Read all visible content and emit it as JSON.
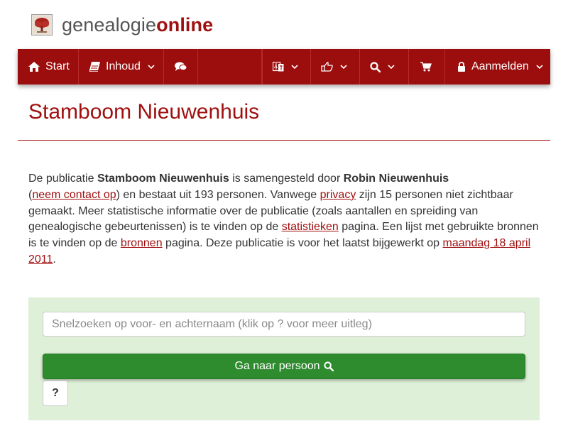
{
  "header": {
    "logo_icon": "tree-icon",
    "logo_part1": "genealogie",
    "logo_part2": "online"
  },
  "colors": {
    "brand": "#9c0d0d",
    "title": "#a01010",
    "panel_bg": "#dff0d8",
    "button_green": "#2e8b2e"
  },
  "nav": {
    "start_label": "Start",
    "start_icon": "home-icon",
    "inhoud_label": "Inhoud",
    "inhoud_icon": "book-icon",
    "chat_icon": "comments-icon",
    "language_icon": "language-icon",
    "share_icon": "share-icon",
    "search_icon": "search-icon",
    "cart_icon": "shopping-cart-icon",
    "login_label": "Aanmelden",
    "login_icon": "lock-icon"
  },
  "page": {
    "title": "Stamboom Nieuwenhuis"
  },
  "intro": {
    "t1": "De publicatie ",
    "pub_name": "Stamboom Nieuwenhuis",
    "t2": " is samengesteld door ",
    "author": "Robin Nieuwenhuis",
    "t3": " (",
    "contact_link": "neem contact op",
    "t4": ") en bestaat uit 193 personen. Vanwege ",
    "privacy_link": "privacy",
    "t5": " zijn 15 personen niet zichtbaar gemaakt. Meer statistische informatie over de publicatie (zoals aantallen en spreiding van genealogische gebeurtenissen) is te vinden op de ",
    "stats_link": "statistieken",
    "t6": " pagina. Een lijst met gebruikte bronnen is te vinden op de ",
    "sources_link": "bronnen",
    "t7": " pagina. Deze publicatie is voor het laatst bijgewerkt op ",
    "date_link": "maandag 18 april 2011",
    "t8": "."
  },
  "search": {
    "placeholder": "Snelzoeken op voor- en achternaam (klik op ? voor meer uitleg)",
    "value": "",
    "go_label": "Ga naar persoon",
    "help_label": "?"
  }
}
